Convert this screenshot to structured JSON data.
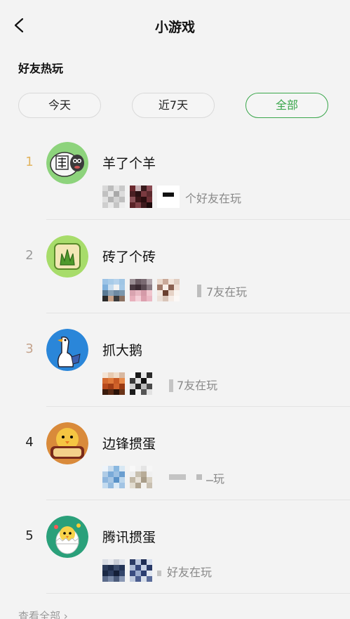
{
  "nav": {
    "title": "小游戏"
  },
  "section": {
    "title": "好友热玩"
  },
  "tabs": [
    {
      "label": "今天",
      "active": false
    },
    {
      "label": "近7天",
      "active": false
    },
    {
      "label": "全部",
      "active": true
    }
  ],
  "games": [
    {
      "rank": "1",
      "name": "羊了个羊",
      "friends_text": "个好友在玩",
      "icon": "sheep-icon"
    },
    {
      "rank": "2",
      "name": "砖了个砖",
      "friends_text": "7友在玩",
      "icon": "grass-tile-icon"
    },
    {
      "rank": "3",
      "name": "抓大鹅",
      "friends_text": "7友在玩",
      "icon": "goose-icon"
    },
    {
      "rank": "4",
      "name": "边锋掼蛋",
      "friends_text": "玩",
      "icon": "chick-icon"
    },
    {
      "rank": "5",
      "name": "腾讯掼蛋",
      "friends_text": "好友在玩",
      "icon": "egg-chick-icon"
    }
  ],
  "footer": {
    "more_label": "查看全部 ›"
  },
  "colors": {
    "accent": "#3aa64b",
    "rank1": "#e2b460"
  }
}
